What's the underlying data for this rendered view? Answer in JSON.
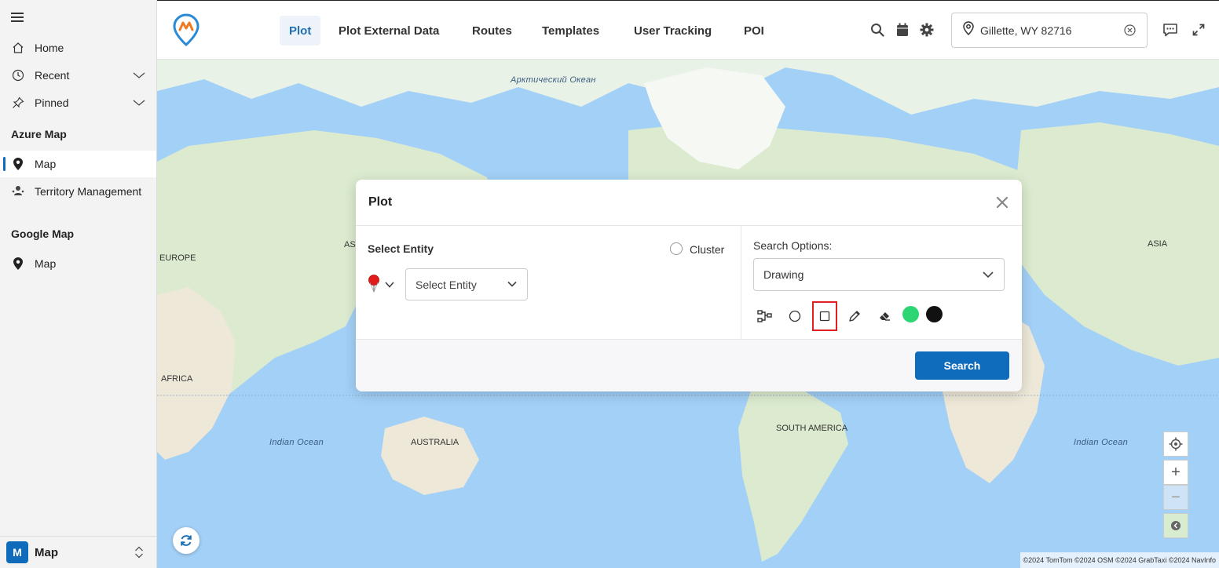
{
  "sidebar": {
    "home": "Home",
    "recent": "Recent",
    "pinned": "Pinned",
    "azure_section": "Azure Map",
    "azure_items": [
      "Map",
      "Territory Management"
    ],
    "google_section": "Google Map",
    "google_items": [
      "Map"
    ],
    "footer": {
      "badge": "M",
      "label": "Map"
    }
  },
  "header": {
    "tabs": [
      "Plot",
      "Plot External Data",
      "Routes",
      "Templates",
      "User Tracking",
      "POI"
    ],
    "active_tab": "Plot",
    "location": "Gillette, WY 82716",
    "icons": [
      "search-icon",
      "calendar-icon",
      "gear-icon",
      "location-pin-icon",
      "clear-icon",
      "chat-icon",
      "expand-icon"
    ]
  },
  "map": {
    "labels": {
      "arctic": "Арктический Океан",
      "europe": "EUROPE",
      "asia_left": "AS",
      "africa": "AFRICA",
      "indian_left": "Indian Ocean",
      "australia": "AUSTRALIA",
      "south_america": "SOUTH AMERICA",
      "asia_right": "ASIA",
      "indian_right": "Indian Ocean"
    },
    "attribution": "©2024 TomTom  ©2024 OSM  ©2024 GrabTaxi  ©2024 NavInfo",
    "controls": {
      "zoom_in": "+",
      "zoom_out": "−"
    }
  },
  "dialog": {
    "title": "Plot",
    "select_entity_label": "Select Entity",
    "cluster_label": "Cluster",
    "select_entity_placeholder": "Select Entity",
    "search_options_label": "Search Options:",
    "search_option_value": "Drawing",
    "tools": [
      "route-icon",
      "circle-icon",
      "square-icon",
      "pencil-icon",
      "eraser-icon"
    ],
    "selected_tool": "square-icon",
    "colors": {
      "fill": "#2ed573",
      "stroke": "#111111"
    },
    "search_button": "Search"
  },
  "colors": {
    "accent": "#0f6cbd",
    "selection": "#e02020",
    "water": "#a3d0f7",
    "land": "#f2efe6"
  }
}
